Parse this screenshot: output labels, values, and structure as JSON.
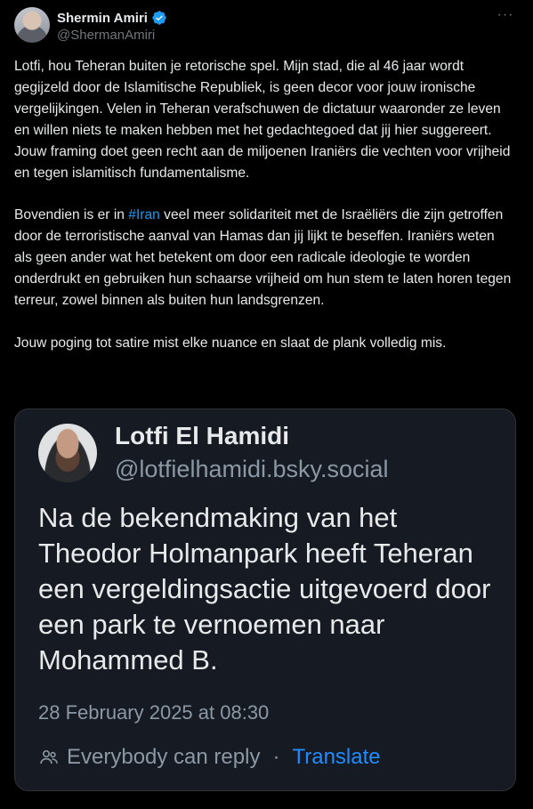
{
  "post": {
    "author_name": "Shermin Amiri",
    "author_handle": "@ShermanAmiri",
    "more_label": "···",
    "paragraphs": [
      "Lotfi, hou Teheran buiten je retorische spel. Mijn stad, die al 46 jaar wordt gegijzeld door de Islamitische Republiek, is geen decor voor jouw ironische vergelijkingen. Velen in Teheran verafschuwen de dictatuur waaronder ze leven en willen niets te maken hebben met het gedachtegoed dat jij hier suggereert. Jouw framing doet geen recht aan de miljoenen Iraniërs die vechten voor vrijheid en tegen islamitisch fundamentalisme.",
      "Jouw poging tot satire mist elke nuance en slaat de plank volledig mis."
    ],
    "para2_before": "Bovendien is er in ",
    "hashtag": "#Iran",
    "para2_after": " veel meer solidariteit met de Israëliërs die zijn getroffen door de terroristische aanval van Hamas dan jij lijkt te beseffen. Iraniërs weten als geen ander wat het betekent om door een radicale ideologie te worden onderdrukt en gebruiken hun schaarse vrijheid om hun stem te laten horen tegen terreur, zowel binnen als buiten hun landsgrenzen."
  },
  "quoted": {
    "author_name": "Lotfi El Hamidi",
    "author_handle": "@lotfielhamidi.bsky.social",
    "text": "Na de bekendmaking van het Theodor Holmanpark heeft Teheran een vergeldingsactie uitgevoerd door een park te vernoemen naar Mohammed B.",
    "date": "28 February 2025 at 08:30",
    "reply_setting": "Everybody can reply",
    "separator": "·",
    "translate_label": "Translate"
  },
  "colors": {
    "background": "#000000",
    "text": "#e7e9ea",
    "muted": "#71767b",
    "accent": "#1d9bf0",
    "card_bg": "#161a22",
    "verified": "#1d9bf0"
  }
}
